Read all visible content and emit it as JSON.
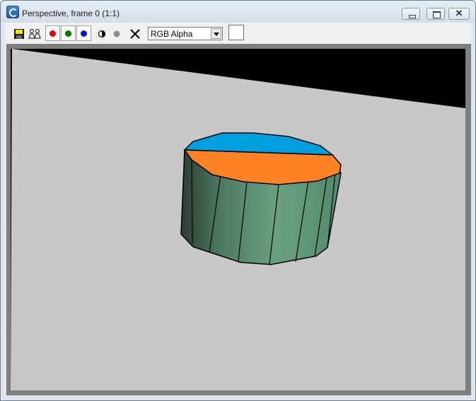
{
  "window": {
    "title": "Perspective, frame 0 (1:1)",
    "close_glyph": "✕"
  },
  "toolbar": {
    "icons": [
      "save-image-icon",
      "clone-window-icon",
      "red-channel-icon",
      "green-channel-icon",
      "blue-channel-icon",
      "monochrome-icon",
      "gray-channel-icon",
      "clear-icon"
    ],
    "channel_select_value": "RGB Alpha",
    "swatch_color": "#ffffff"
  },
  "render": {
    "background": "#c8c8c8",
    "shadow_color": "#000000",
    "cylinder_side": "#5e9274",
    "cap_blue": "#00a0e0",
    "cap_orange": "#ff8224"
  }
}
